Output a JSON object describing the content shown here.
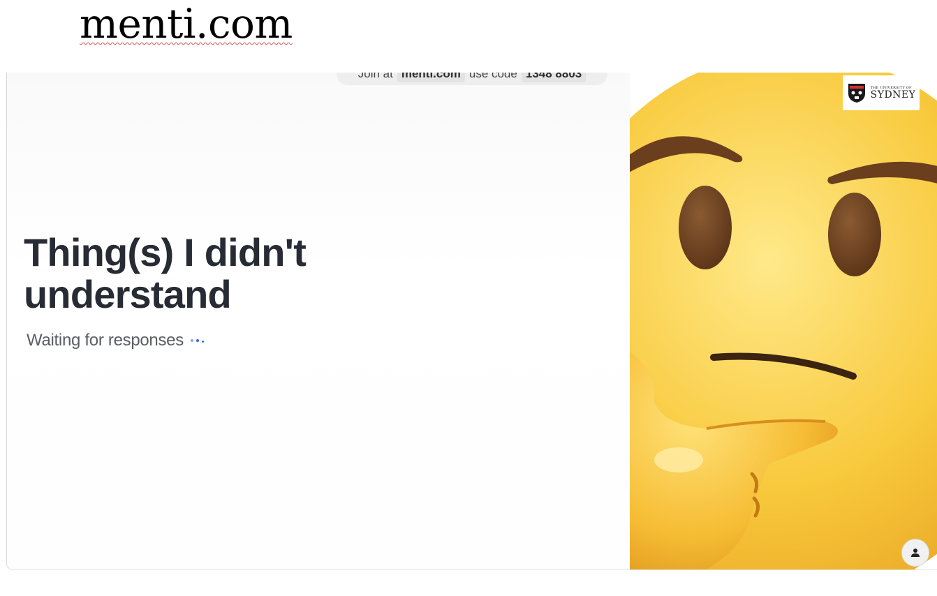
{
  "document": {
    "title": "menti.com"
  },
  "slide": {
    "join_bar": {
      "prefix": "Join at",
      "site": "menti.com",
      "middle": "use code",
      "code": "1348 8803"
    },
    "question": "Thing(s) I didn't understand",
    "status": "Waiting for responses",
    "accent_color": "#3f63e8",
    "image": {
      "icon": "thinking-face-emoji"
    },
    "logo": {
      "small_text": "THE UNIVERSITY OF",
      "big_text": "SYDNEY"
    },
    "user_button_icon": "person-icon"
  }
}
